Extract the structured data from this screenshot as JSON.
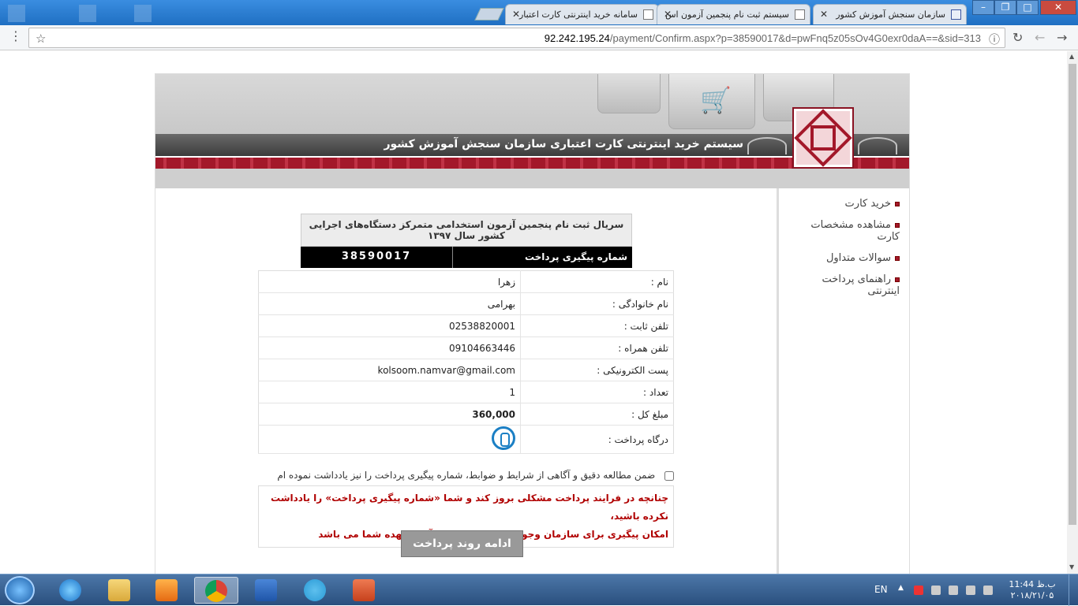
{
  "browser": {
    "tabs": [
      {
        "title": "سازمان سنجش آموزش کشور",
        "active": false
      },
      {
        "title": "سیستم ثبت نام پنجمین آزمون اس",
        "active": false
      },
      {
        "title": "سامانه خرید اینترنتی کارت اعتبار",
        "active": true
      }
    ],
    "url_host": "92.242.195.24",
    "url_path": "/payment/Confirm.aspx?p=38590017&d=pwFnq5z05sOv4G0exr0daA==&sid=313"
  },
  "site": {
    "title": "سیستم خرید اینترنتی کارت اعتباری سازمان سنجش آموزش کشور",
    "sidebar": [
      "خرید کارت",
      "مشاهده مشخصات کارت",
      "سوالات متداول",
      "راهنمای پرداخت اینترنتی"
    ],
    "serial_title": "سریال ثبت نام پنجمین آزمون استخدامی متمرکز دستگاه‌های اجرایی کشور سال ۱۳۹۷",
    "tracking_label": "شماره پیگیری پرداخت",
    "tracking_value": "38590017",
    "fields": [
      {
        "label": "نام :",
        "value": "زهرا"
      },
      {
        "label": "نام خانوادگی :",
        "value": "بهرامی"
      },
      {
        "label": "تلفن ثابت :",
        "value": "02538820001"
      },
      {
        "label": "تلفن همراه :",
        "value": "09104663446"
      },
      {
        "label": "پست الکترونیکی :",
        "value": "kolsoom.namvar@gmail.com"
      },
      {
        "label": "تعداد :",
        "value": "1"
      },
      {
        "label": "مبلغ کل :",
        "value": "360,000"
      },
      {
        "label": "درگاه پرداخت :",
        "value": ""
      }
    ],
    "agree_text": "ضمن مطالعه دقیق و آگاهی از شرایط و ضوابط، شماره پیگیری پرداخت را نیز یادداشت نموده ام",
    "warning_line1": "چنانچه در فرایند پرداخت مشکلی بروز کند و شما «شماره پیگیری پرداخت» را یادداشت نکرده باشید،",
    "warning_line2": "امکان پیگیری برای سازمان وجود ندارد و مسئولیت آن برعهده شما می باشد",
    "continue_label": "ادامه روند پرداخت"
  },
  "taskbar": {
    "lang": "EN",
    "time": "11:44 ب.ظ",
    "date": "۲۰۱۸/۲۱/۰۵"
  }
}
